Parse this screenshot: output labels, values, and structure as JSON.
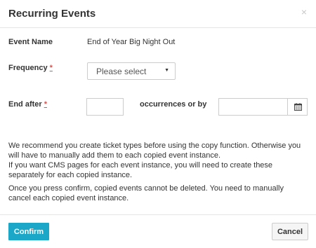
{
  "dialog": {
    "title": "Recurring Events",
    "close_icon": "×"
  },
  "form": {
    "event_name_label": "Event Name",
    "event_name_value": "End of Year Big Night Out",
    "frequency_label": "Frequency",
    "frequency_required": "*",
    "frequency_selected": "Please select",
    "end_after_label": "End after",
    "end_after_required": "*",
    "occurrences_value": "",
    "occurrences_label": "occurrences or by",
    "end_date_value": "",
    "calendar_icon": "calendar-icon"
  },
  "notes": {
    "paragraph1": "We recommend you create ticket types before using the copy function. Otherwise you will have to manually add them to each copied event instance.",
    "paragraph2": "If you want CMS pages for each event instance, you will need to create these separately for each copied instance.",
    "paragraph3": "Once you press confirm, copied events cannot be deleted. You need to manually cancel each copied event instance."
  },
  "footer": {
    "confirm_label": "Confirm",
    "cancel_label": "Cancel"
  },
  "colors": {
    "primary": "#1ba8c8",
    "required": "#d9534f"
  }
}
